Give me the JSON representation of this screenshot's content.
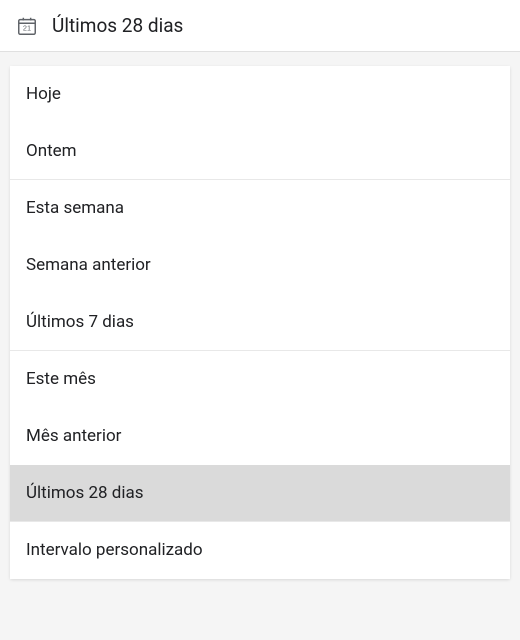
{
  "header": {
    "label": "Últimos 28 dias"
  },
  "options": {
    "today": "Hoje",
    "yesterday": "Ontem",
    "thisWeek": "Esta semana",
    "previousWeek": "Semana anterior",
    "last7Days": "Últimos 7 dias",
    "thisMonth": "Este mês",
    "previousMonth": "Mês anterior",
    "last28Days": "Últimos 28 dias",
    "customRange": "Intervalo personalizado"
  }
}
